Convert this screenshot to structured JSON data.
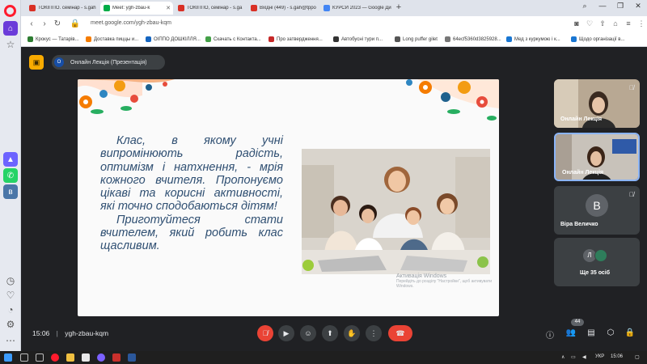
{
  "browser": {
    "tabs": [
      {
        "label": "ТОКІППО. семінар - s.gah",
        "active": false,
        "favicon_color": "#d93025"
      },
      {
        "label": "Meet: ygh-zbau-k",
        "active": true,
        "favicon_color": "#00ac47"
      },
      {
        "label": "ТОКІППО, семінар - s.ga",
        "active": false,
        "favicon_color": "#d93025"
      },
      {
        "label": "Вхідні (449) - s.gah@tppo",
        "active": false,
        "favicon_color": "#d93025"
      },
      {
        "label": "КУРСИ 2023 — Google Ди",
        "active": false,
        "favicon_color": "#4285f4"
      }
    ],
    "url": "meet.google.com/ygh-zbau-kqm",
    "bookmarks": [
      {
        "label": "Крокус — Татарів...",
        "color": "#2e7d32"
      },
      {
        "label": "Доставка пиццы и...",
        "color": "#f57c00"
      },
      {
        "label": "ОІППО ДОШКІЛЛЯ...",
        "color": "#1565c0"
      },
      {
        "label": "Скачать с Контакта...",
        "color": "#43a047"
      },
      {
        "label": "Про затвердження...",
        "color": "#c62828"
      },
      {
        "label": "Автобусні тури п...",
        "color": "#333333"
      },
      {
        "label": "Long puffer gilet",
        "color": "#555555"
      },
      {
        "label": "64ecf5360d3825928...",
        "color": "#777777"
      },
      {
        "label": "Мед з куркумою і к...",
        "color": "#1976d2"
      },
      {
        "label": "Щодо організації в...",
        "color": "#1976d2"
      }
    ]
  },
  "meet": {
    "presenter_badge": "О",
    "presentation_title": "Онлайн Лекція (Презентація)",
    "slide": {
      "paragraph1": "Клас, в якому учні випромінюють радість, оптимізм і натхнення, - мрія кожного вчителя. Пропонуємо цікаві та корисні активності, які точно сподобаються дітям!",
      "paragraph2": "Приготуйтеся стати вчителем, який робить клас щасливим.",
      "activation_title": "Активація Windows",
      "activation_sub": "Перейдіть до розділу \"Настройки\", щоб активувати Windows."
    },
    "participants": [
      {
        "name": "Онлайн Лекція",
        "type": "video"
      },
      {
        "name": "Онлайн Лекція",
        "type": "video"
      },
      {
        "name": "Віра Величко",
        "type": "avatar",
        "initial": "В"
      },
      {
        "name": "Ще 35 осіб",
        "type": "more",
        "initial": "Л"
      }
    ],
    "bottom": {
      "time": "15:06",
      "meeting_code": "ygh-zbau-kqm",
      "participants_count": "44"
    }
  },
  "taskbar": {
    "lang": "УКР",
    "time": "15:06"
  },
  "colors": {
    "meet_bg": "#202124",
    "hangup": "#ea4335",
    "slide_text": "#2f4f72",
    "presenting_icon": "#f9ab00"
  }
}
